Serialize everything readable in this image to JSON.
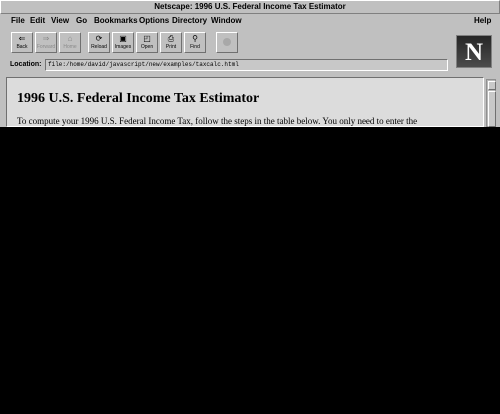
{
  "window": {
    "title": "Netscape: 1996 U.S. Federal Income Tax Estimator"
  },
  "menubar": {
    "items": [
      "File",
      "Edit",
      "View",
      "Go",
      "Bookmarks",
      "Options",
      "Directory",
      "Window"
    ],
    "help": "Help"
  },
  "toolbar": {
    "buttons": [
      {
        "label": "Back",
        "icon": "arrow-left-icon",
        "enabled": true
      },
      {
        "label": "Forward",
        "icon": "arrow-right-icon",
        "enabled": false
      },
      {
        "label": "Home",
        "icon": "home-icon",
        "enabled": false
      },
      {
        "label": "Reload",
        "icon": "reload-icon",
        "enabled": true
      },
      {
        "label": "Images",
        "icon": "images-icon",
        "enabled": true
      },
      {
        "label": "Open",
        "icon": "open-icon",
        "enabled": true
      },
      {
        "label": "Print",
        "icon": "print-icon",
        "enabled": true
      },
      {
        "label": "Find",
        "icon": "find-icon",
        "enabled": true
      }
    ],
    "stop_icon": "stop-icon"
  },
  "logo": {
    "letter": "N"
  },
  "location": {
    "label": "Location:",
    "url": "file:/home/david/javascript/new/examples/taxcalc.html"
  },
  "page": {
    "title": "1996 U.S. Federal Income Tax Estimator",
    "intro": "To compute your 1996 U.S. Federal Income Tax, follow the steps in the table below. You only need to enter the"
  }
}
